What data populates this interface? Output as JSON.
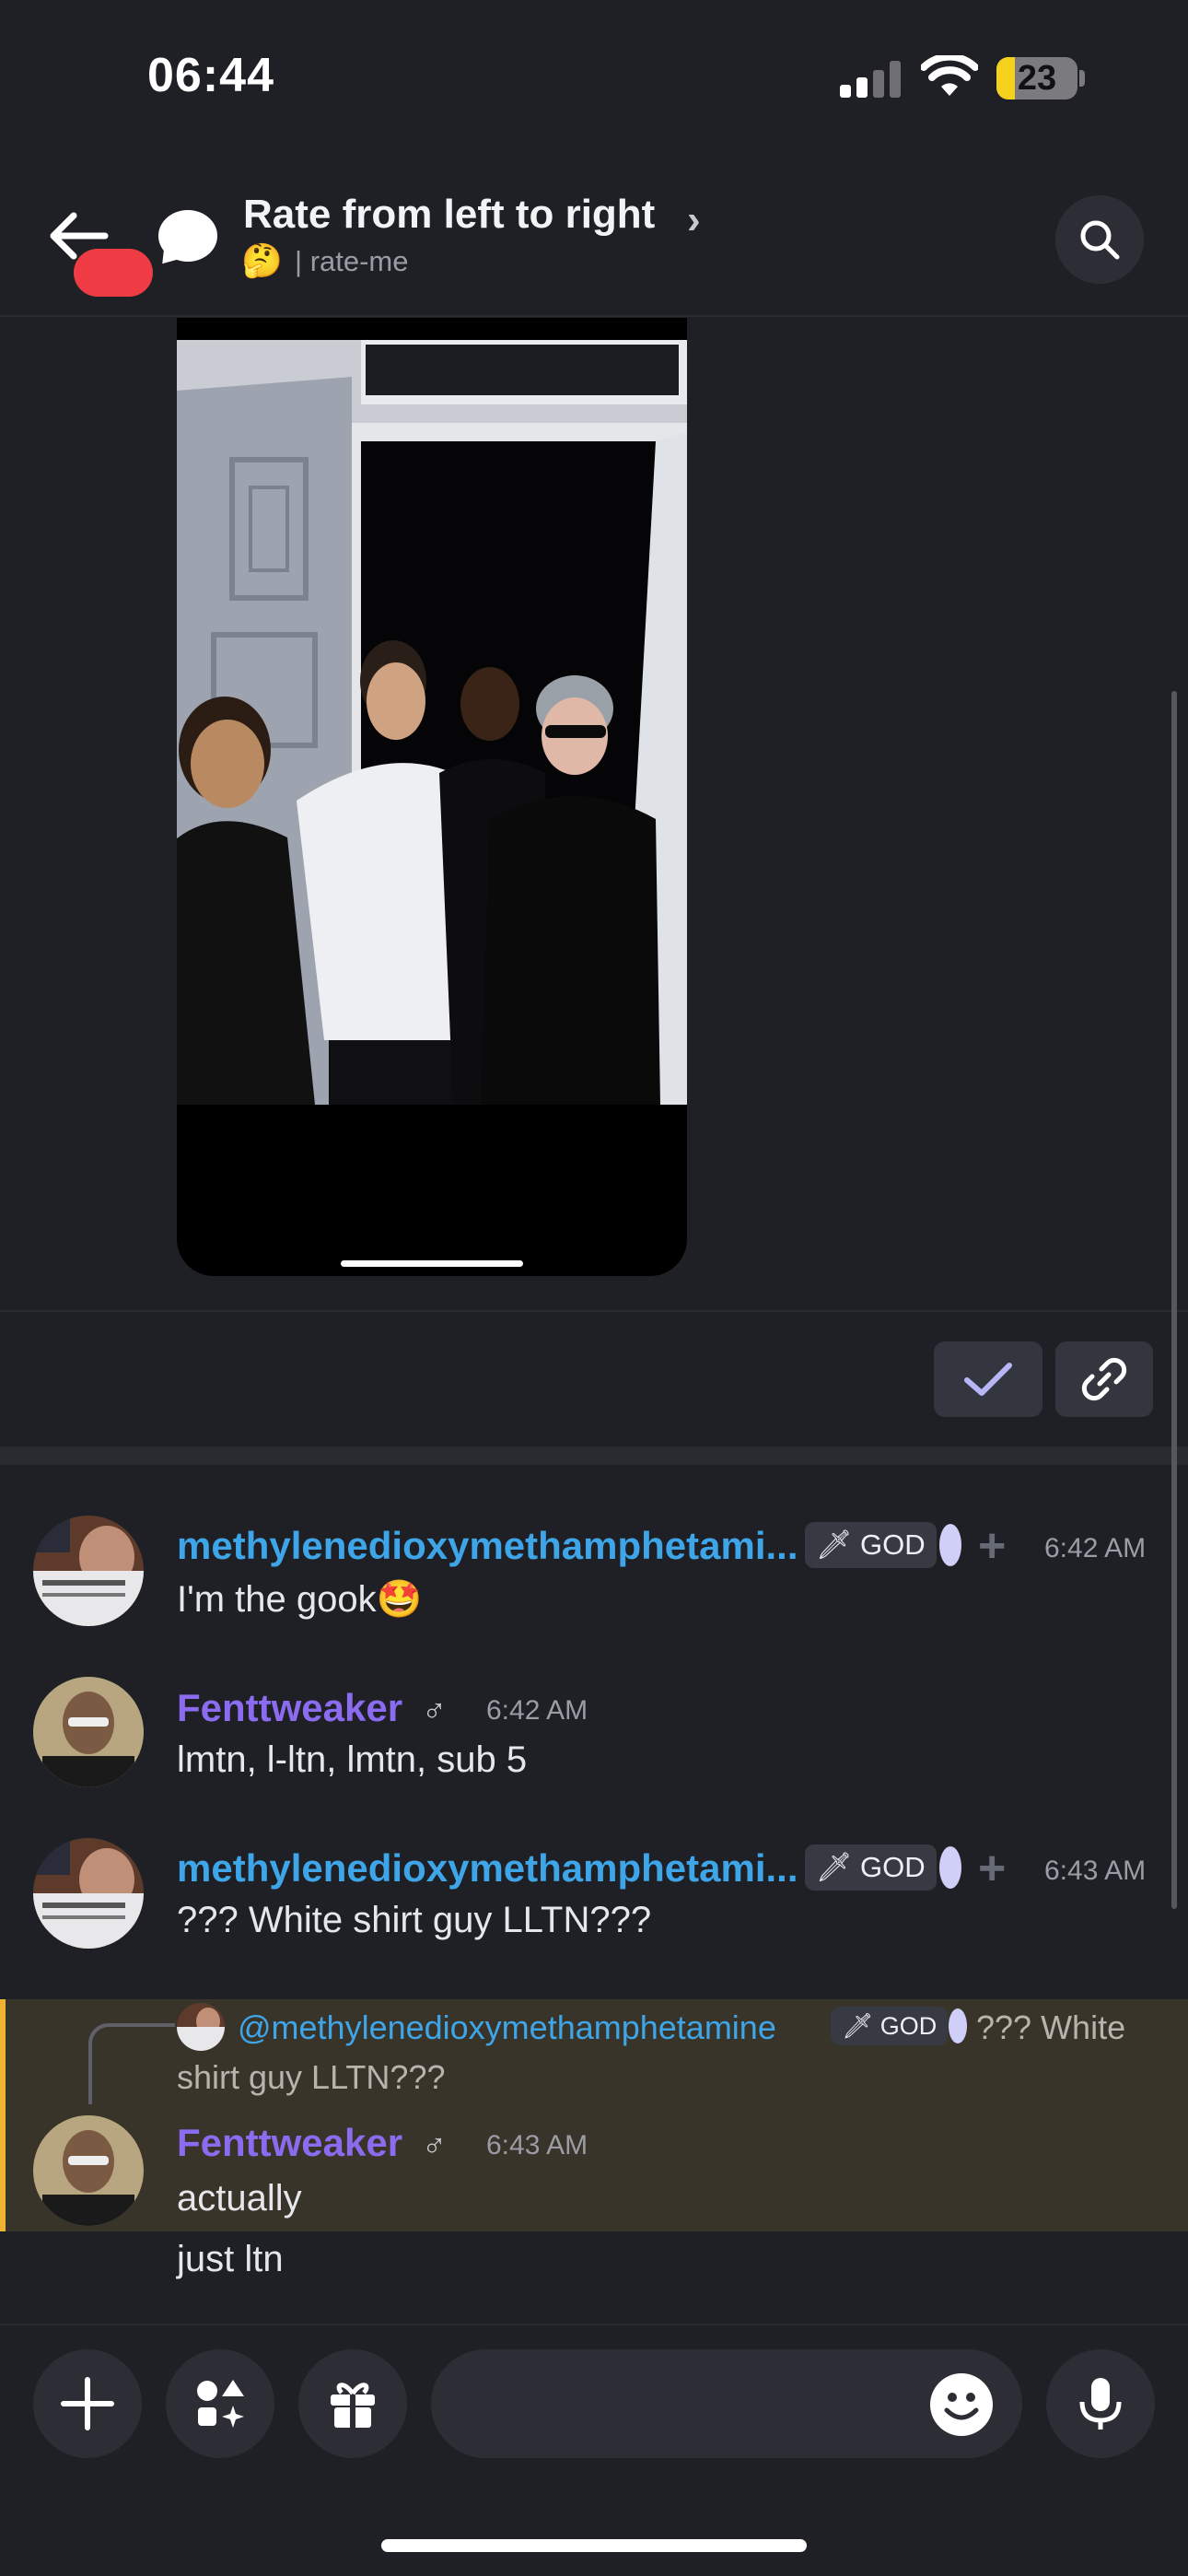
{
  "status_bar": {
    "time": "06:44",
    "battery": "23",
    "battery_level": 0.23
  },
  "header": {
    "title": "Rate from left to right",
    "chevron": "›",
    "channel_emoji": "🤔",
    "channel_sep": "|",
    "channel": "rate-me"
  },
  "icons": {
    "back": "arrow-left-icon",
    "search": "search-icon",
    "check": "check-icon",
    "link": "link-icon"
  },
  "messages": [
    {
      "username": "methylenedioxymethamphetami...",
      "role_tag": "GOD",
      "timestamp": "6:42 AM",
      "text": "I'm the gook🤩"
    },
    {
      "username": "Fenttweaker",
      "gender": "♂",
      "timestamp": "6:42 AM",
      "text": "lmtn, l-ltn, lmtn, sub 5"
    },
    {
      "username": "methylenedioxymethamphetami...",
      "role_tag": "GOD",
      "timestamp": "6:43 AM",
      "text": "??? White shirt guy LLTN???"
    }
  ],
  "reply": {
    "mention": "@methylenedioxymethamphetamine",
    "role_tag": "GOD",
    "quote_part1": "??? White",
    "quote_part2": "shirt guy LLTN???",
    "username": "Fenttweaker",
    "gender": "♂",
    "timestamp": "6:43 AM",
    "lines": [
      "actually",
      "just ltn"
    ]
  },
  "colors": {
    "background": "#1f2026",
    "username_blue": "#3ea6e8",
    "username_purple": "#8b6cf0",
    "reply_highlight": "#39342a",
    "reply_bar": "#f0b232",
    "battery": "#f3d11c"
  },
  "input": {
    "placeholder": ""
  }
}
